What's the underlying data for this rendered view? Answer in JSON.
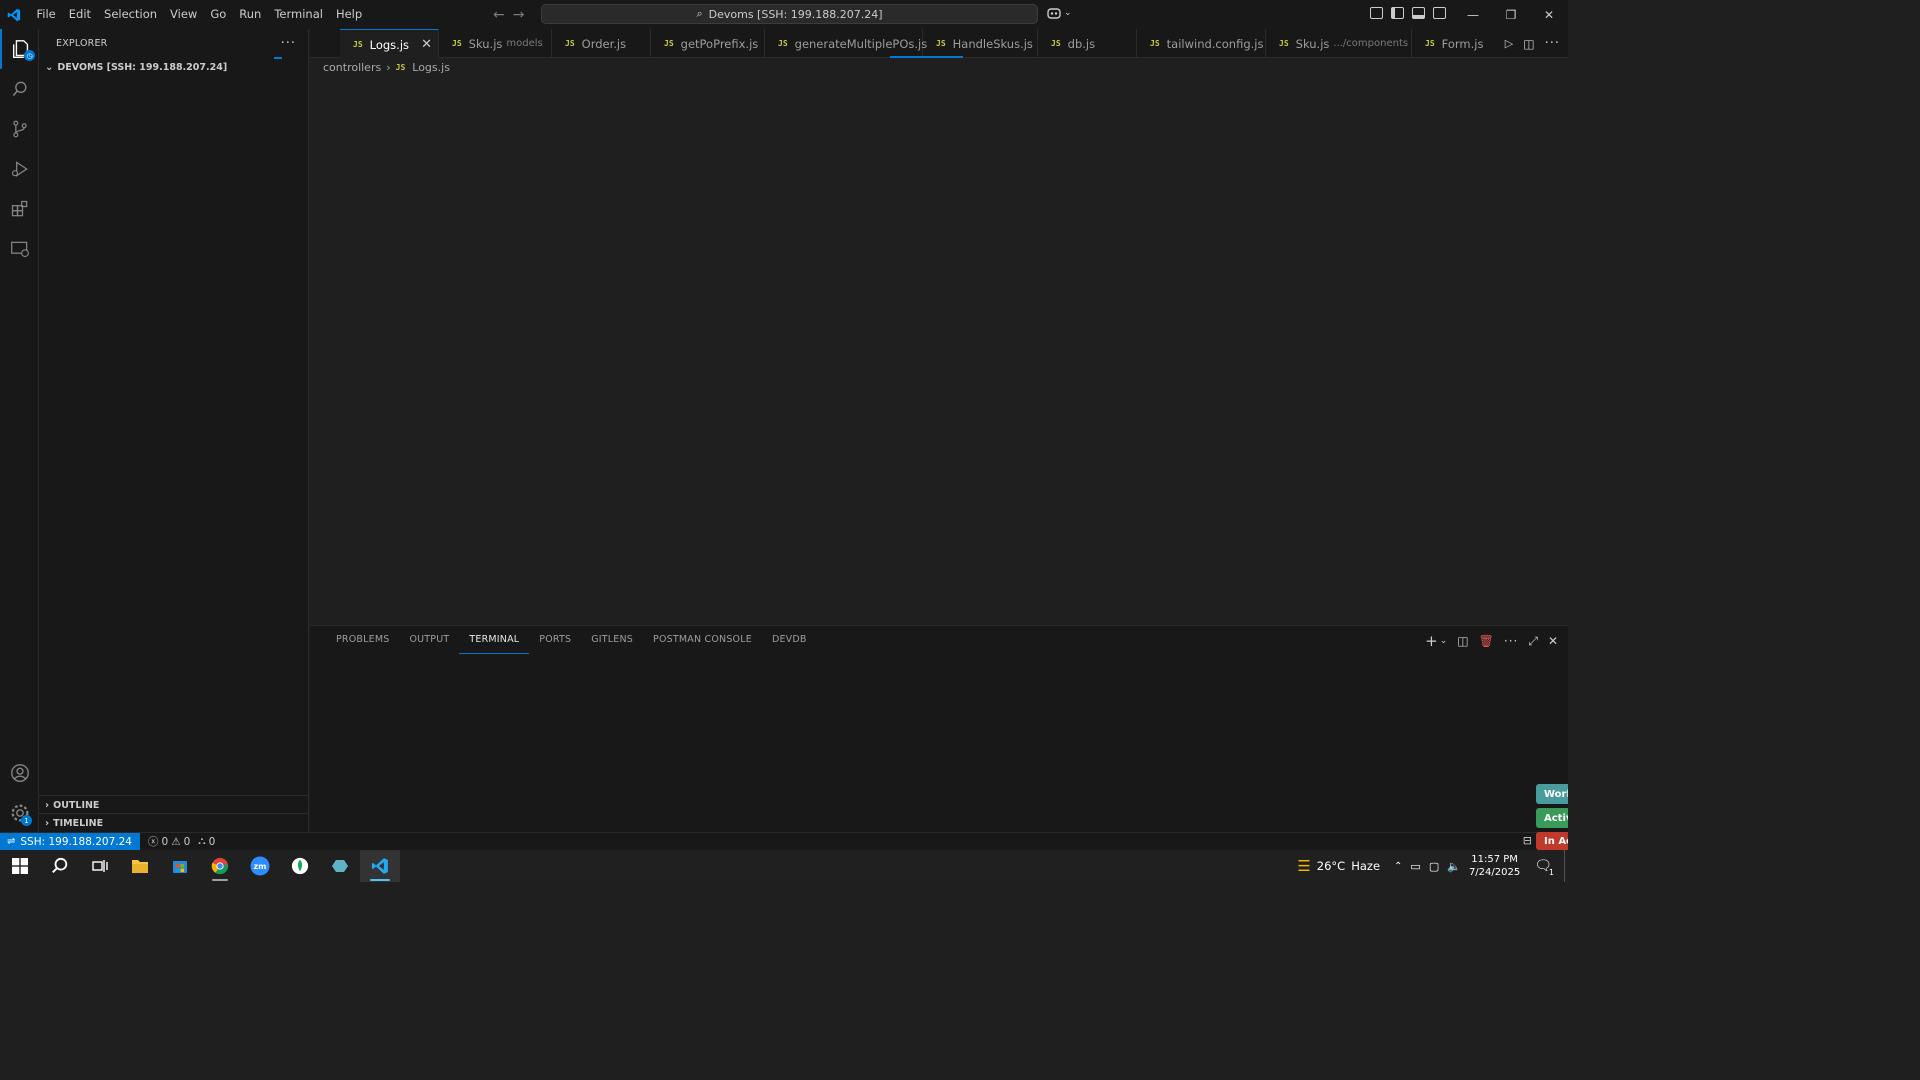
{
  "menu": [
    "File",
    "Edit",
    "Selection",
    "View",
    "Go",
    "Run",
    "Terminal",
    "Help"
  ],
  "command_center": "Devoms [SSH: 199.188.207.24]",
  "explorer": {
    "title": "EXPLORER",
    "folder": "DEVOMS [SSH: 199.188.207.24]",
    "outline": "OUTLINE",
    "timeline": "TIMELINE"
  },
  "activity_badges": {
    "explorer": "",
    "settings": "1"
  },
  "tabs": [
    {
      "label": "Logs.js",
      "desc": "",
      "active": true
    },
    {
      "label": "Sku.js",
      "desc": "models"
    },
    {
      "label": "Order.js",
      "desc": ""
    },
    {
      "label": "getPoPrefix.js",
      "desc": ""
    },
    {
      "label": "generateMultiplePOs.js",
      "desc": ""
    },
    {
      "label": "HandleSkus.js",
      "desc": ""
    },
    {
      "label": "db.js",
      "desc": ""
    },
    {
      "label": "tailwind.config.js",
      "desc": ""
    },
    {
      "label": "Sku.js",
      "desc": ".../components"
    },
    {
      "label": "Form.js",
      "desc": ""
    }
  ],
  "file_icon_label": "JS",
  "breadcrumb": {
    "folder": "controllers",
    "file": "Logs.js"
  },
  "panel_tabs": [
    "PROBLEMS",
    "OUTPUT",
    "TERMINAL",
    "PORTS",
    "GITLENS",
    "POSTMAN CONSOLE",
    "DEVDB"
  ],
  "panel_active": "TERMINAL",
  "side_status": [
    "Work",
    "Activ",
    "In Ac"
  ],
  "status": {
    "remote": "SSH: 199.188.207.24",
    "errors": "0",
    "warnings": "0",
    "ports": "0"
  },
  "taskbar": {
    "weather_temp": "26°C",
    "weather_desc": "Haze",
    "time": "11:57 PM",
    "date": "7/24/2025",
    "notifications": "1"
  },
  "colors": {
    "accent": "#0078d4",
    "js_icon": "#cbcb41",
    "work_status": "#4a9c9c",
    "active_status": "#3a9a5a",
    "inactive_status": "#c0392b"
  }
}
